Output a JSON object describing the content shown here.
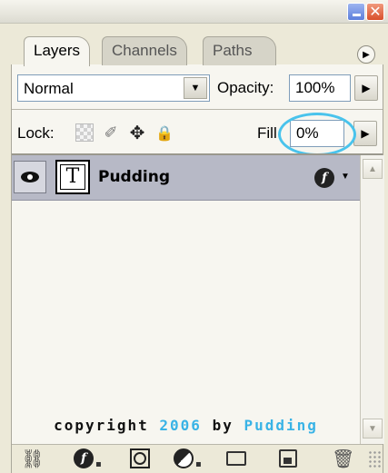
{
  "window": {
    "minimize_icon": "minimize-icon",
    "close_glyph": "✕"
  },
  "tabs": [
    {
      "label": "Layers",
      "active": true
    },
    {
      "label": "Channels",
      "active": false
    },
    {
      "label": "Paths",
      "active": false
    }
  ],
  "panel_menu_glyph": "▶",
  "blend": {
    "value": "Normal",
    "dropdown_glyph": "▼"
  },
  "opacity": {
    "label": "Opacity:",
    "value": "100%",
    "arrow_glyph": "▶"
  },
  "lock": {
    "label": "Lock:",
    "icons": [
      "lock-transparency-icon",
      "lock-image-icon",
      "lock-position-icon",
      "lock-all-icon"
    ],
    "brush_glyph": "✐",
    "move_glyph": "✥",
    "lock_glyph": "🔒"
  },
  "fill": {
    "label": "Fill",
    "value": "0%",
    "arrow_glyph": "▶",
    "highlight_color": "#49c3ec"
  },
  "layers": [
    {
      "name": "Pudding",
      "thumb_glyph": "T",
      "visible": true,
      "has_effects": true,
      "fx_glyph": "f",
      "fx_arrow": "▼"
    }
  ],
  "scrollbar": {
    "up_glyph": "▲",
    "down_glyph": "▼"
  },
  "copyright": {
    "part1": "copyright ",
    "year": "2006",
    "part2": " by ",
    "author": "Pudding",
    "accent_color": "#39b3e6"
  },
  "toolbar": {
    "link_glyph": "⛓",
    "fx_glyph": "f",
    "dot_glyph": "▪",
    "trash_glyph": "🗑"
  }
}
